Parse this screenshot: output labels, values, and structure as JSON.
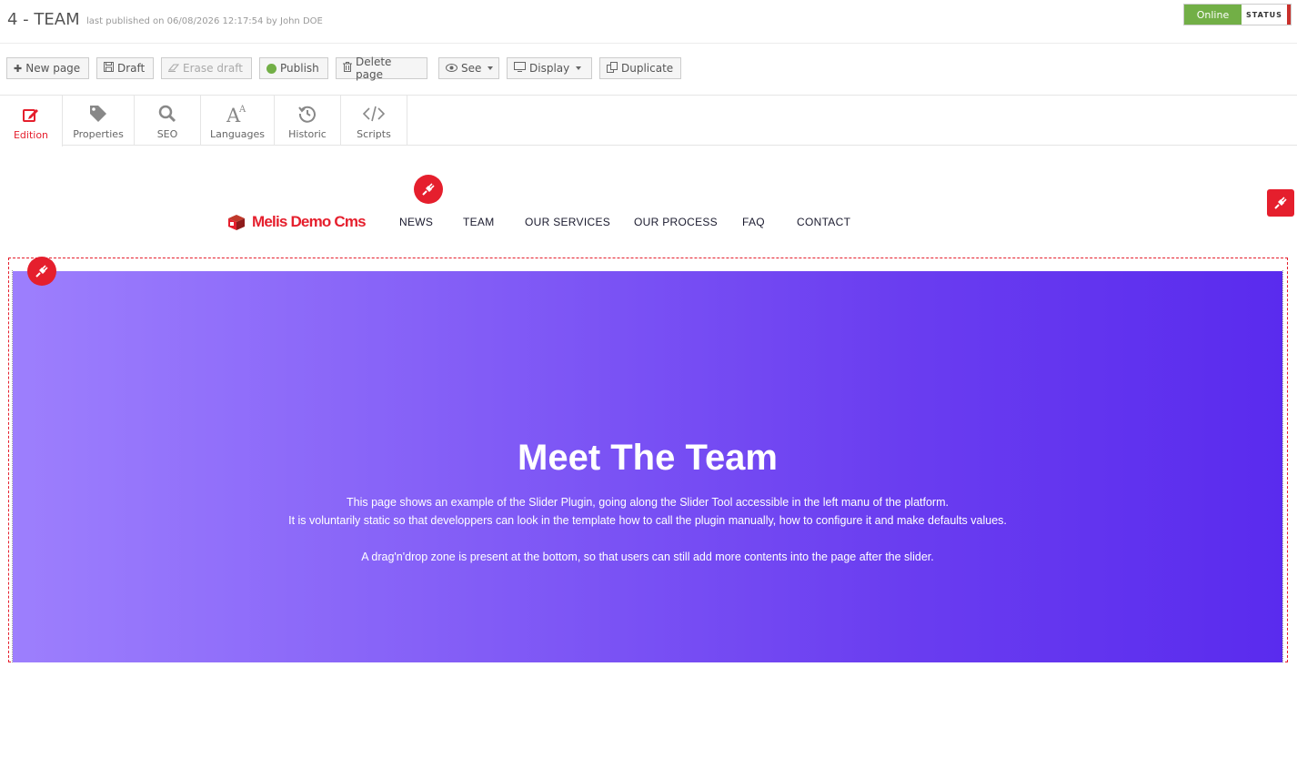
{
  "header": {
    "title": "4 - TEAM",
    "published_info": "last published on 06/08/2026 12:17:54 by John DOE",
    "status_value": "Online",
    "status_label": "STATUS"
  },
  "toolbar": {
    "new_page": "New page",
    "draft": "Draft",
    "erase_draft": "Erase draft",
    "publish": "Publish",
    "delete_page": "Delete page",
    "see": "See",
    "display": "Display",
    "duplicate": "Duplicate"
  },
  "tabs": [
    {
      "label": "Edition",
      "icon": "edit-icon"
    },
    {
      "label": "Properties",
      "icon": "tag-icon"
    },
    {
      "label": "SEO",
      "icon": "search-icon"
    },
    {
      "label": "Languages",
      "icon": "font-size-icon"
    },
    {
      "label": "Historic",
      "icon": "history-icon"
    },
    {
      "label": "Scripts",
      "icon": "code-icon"
    }
  ],
  "site": {
    "logo_text": "Melis Demo Cms",
    "nav": [
      "NEWS",
      "TEAM",
      "OUR SERVICES",
      "OUR PROCESS",
      "FAQ",
      "CONTACT"
    ]
  },
  "hero": {
    "title": "Meet The Team",
    "line1": "This page shows an example of the Slider Plugin, going along the Slider Tool accessible in the left manu of the platform.",
    "line2": "It is voluntarily static so that developpers can look in the template how to call the plugin manually, how to configure it and make defaults values.",
    "line3": "A drag'n'drop zone is present at the bottom, so that users can still add more contents into the page after the slider."
  },
  "colors": {
    "accent": "#e51f2d",
    "online": "#72af46",
    "hero_start": "#9d7ffd",
    "hero_end": "#5a2bee"
  }
}
